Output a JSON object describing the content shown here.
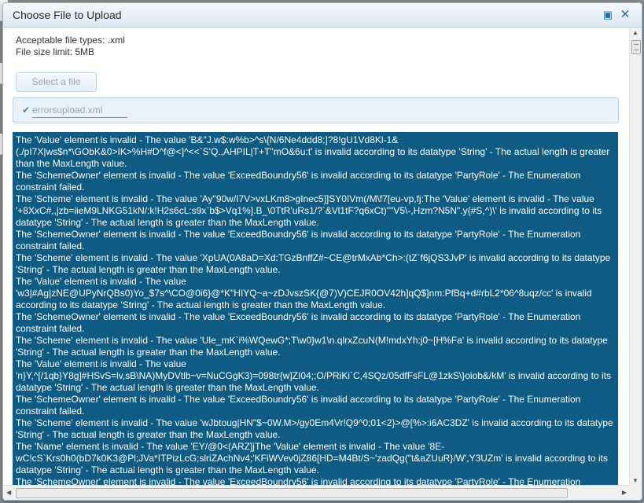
{
  "dialog": {
    "title": "Choose File to Upload",
    "accepted_types": "Acceptable file types: .xml",
    "size_limit": "File size limit: 5MB",
    "select_button": "Select a file",
    "file": {
      "name": "errorsupload.xml",
      "progress_percent": 100
    }
  },
  "icons": {
    "maximize": "maximize-icon",
    "close": "close-icon",
    "check": "check-icon"
  },
  "colors": {
    "error_panel_bg": "#0e5b84",
    "accent": "#1f6ea8"
  },
  "errors": [
    "The 'Value' element is invalid - The value 'B&\"J.w$:w%b>^s\\{N/6Ne4ddd8;]?8!gU1Vd8Kl-1& (./pI7X|ws$n*\\GObK&0>IK>%H#D^f@<]^<<`S'Q.,AHPIL|T+T\"mO&6u:t' is invalid according to its datatype 'String' - The actual length is greater than the MaxLength value.",
    "The 'SchemeOwner' element is invalid - The value 'ExceedBoundry56' is invalid according to its datatype 'PartyRole' - The Enumeration constraint failed.",
    "The 'Scheme' element is invalid - The value 'Ay\"90w/I7V>vxLKm8>gInec5]]SY0IVm(/M\\f7[eu-vp,fj:The 'Value' element is invalid - The value '+8XxC#,,jzb=iieM9LNKG51kN/:k!H2s6cL:s9x`b$>Vq1%].B_\\0TtR'uRs1/?`&Vl1tF?q6xCt)\"\"V5\\-,Hzm?N5N\".y{#S,^)\\' is invalid according to its datatype 'String' - The actual length is greater than the MaxLength value.",
    "The 'SchemeOwner' element is invalid - The value 'ExceedBoundry56' is invalid according to its datatype 'PartyRole' - The Enumeration constraint failed.",
    "The 'Scheme' element is invalid - The value 'XpUA(0A8aD=Xd:TGzBnffZ#~CE@trMxAb*Ch>:(tZ`f6jQS3JvP' is invalid according to its datatype 'String' - The actual length is greater than the MaxLength value.",
    "The 'Value' element is invalid - The value 'w3|#Ag|zNE@UPyNrQBs0)Yo_$7s^\\CO@0i6}@*K\"HIYQ~a~zDJvszSK{@7)V)CEJR0OV42h]qQ$]nm:PfBq+d#rbL2*06^8uqz/cc' is invalid according to its datatype 'String' - The actual length is greater than the MaxLength value.",
    "The 'SchemeOwner' element is invalid - The value 'ExceedBoundry56' is invalid according to its datatype 'PartyRole' - The Enumeration constraint failed.",
    "The 'Scheme' element is invalid - The value 'Ule_mK`i%WQewG*;T\\w0}w1\\n.qlrxZcuN(M!mdxYh:j0~[H%Fa' is invalid according to its datatype 'String' - The actual length is greater than the MaxLength value.",
    "The 'Value' element is invalid - The value 'n}Y,^[/1qb}Y8g]#HSvS=lv,sB\\NA)MyDVtlb~v=NuCGgK3)=098tr{w]ZI04;;O/PRiKi`C,4SQz/05dfFsFL@1zkS\\}oiob&/kM' is invalid according to its datatype 'String' - The actual length is greater than the MaxLength value.",
    "The 'SchemeOwner' element is invalid - The value 'ExceedBoundry56' is invalid according to its datatype 'PartyRole' - The Enumeration constraint failed.",
    "The 'Scheme' element is invalid - The value 'wJbtoug|HN\"$~0W.M>/gy0Em4Vr!Q9^0;01<2}>@[%>:i6AC3DZ' is invalid according to its datatype 'String' - The actual length is greater than the MaxLength value.",
    "The 'Name' element is invalid - The value 'EY/@0<(ARZ]jThe 'Value' element is invalid - The value '8E-wC!cS`Krs0h0(bD7k0K3@Pl;JVa*ITPizLcG;slriZAchNv4;'KFiWVev0jZ86[HD=M4Bt/S~'zadQg(\"t&aZUuR}/W',Y3UZm' is invalid according to its datatype 'String' - The actual length is greater than the MaxLength value.",
    "The 'SchemeOwner' element is invalid - The value 'ExceedBoundry56' is invalid according to its datatype 'PartyRole' - The Enumeration constraint failed."
  ]
}
